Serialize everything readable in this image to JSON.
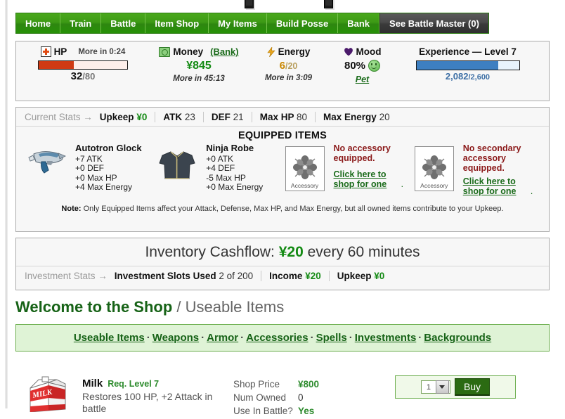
{
  "nav": {
    "items": [
      {
        "label": "Home",
        "active": false
      },
      {
        "label": "Train",
        "active": false
      },
      {
        "label": "Battle",
        "active": false
      },
      {
        "label": "Item Shop",
        "active": false
      },
      {
        "label": "My Items",
        "active": false
      },
      {
        "label": "Build Posse",
        "active": false
      },
      {
        "label": "Bank",
        "active": false
      },
      {
        "label": "See Battle Master (0)",
        "active": true
      }
    ]
  },
  "stats": {
    "hp": {
      "label": "HP",
      "timer": "More in 0:24",
      "current": "32",
      "max": "/80",
      "percent": 40,
      "bar_color": "#cf3a14",
      "bar_bg": "#fdeeea"
    },
    "money": {
      "label": "Money",
      "bank_link": "(Bank)",
      "amount": "¥845",
      "timer": "More in 45:13",
      "color": "#138a13"
    },
    "energy": {
      "label": "Energy",
      "current": "6",
      "max": "/20",
      "timer": "More in 3:09",
      "color": "#c98700"
    },
    "mood": {
      "label": "Mood",
      "percent": "80%",
      "pet_link": "Pet"
    },
    "experience": {
      "label": "Experience — Level 7",
      "current": "2,082",
      "max": "/2,600",
      "percent": 80,
      "bar_color": "#3d7fc1",
      "bar_bg": "#e8f4fd"
    }
  },
  "current_stats": {
    "label": "Current Stats →",
    "items": [
      {
        "key": "Upkeep",
        "value": "¥0",
        "yen": true
      },
      {
        "key": "ATK",
        "value": "23",
        "yen": false
      },
      {
        "key": "DEF",
        "value": "21",
        "yen": false
      },
      {
        "key": "Max HP",
        "value": "80",
        "yen": false
      },
      {
        "key": "Max Energy",
        "value": "20",
        "yen": false
      }
    ]
  },
  "equipped": {
    "title": "EQUIPPED ITEMS",
    "weapon": {
      "name": "Autotron Glock",
      "stats": [
        "+7 ATK",
        "+0 DEF",
        "+0 Max HP",
        "+4 Max Energy"
      ]
    },
    "armor": {
      "name": "Ninja Robe",
      "stats": [
        "+0 ATK",
        "+4 DEF",
        "-5 Max HP",
        "+0 Max Energy"
      ]
    },
    "accessory": {
      "caption": "Accessory",
      "empty_text": "No accessory equipped.",
      "link_text": "Click here to shop for one"
    },
    "secondary_accessory": {
      "caption": "Accessory",
      "empty_text": "No secondary accessory equipped.",
      "link_text": "Click here to shop for one"
    },
    "note_bold": "Note:",
    "note_text": " Only Equipped Items affect your Attack, Defense, Max HP, and Max Energy, but all owned items contribute to your Upkeep."
  },
  "cashflow": {
    "title_prefix": "Inventory Cashflow: ",
    "amount": "¥20",
    "title_suffix": " every 60 minutes",
    "stats_label": "Investment Stats →",
    "items": [
      {
        "key": "Investment Slots Used",
        "value": "2 of 200",
        "yen": false
      },
      {
        "key": "Income",
        "value": "¥20",
        "yen": true
      },
      {
        "key": "Upkeep",
        "value": "¥0",
        "yen": true
      }
    ]
  },
  "shop": {
    "heading_bold": "Welcome to the Shop",
    "heading_rest": " / Useable Items",
    "categories": [
      "Useable Items",
      "Weapons",
      "Armor",
      "Accessories",
      "Spells",
      "Investments",
      "Backgrounds"
    ],
    "category_separator": "·"
  },
  "item": {
    "icon": "milk-carton-icon",
    "name": "Milk",
    "req": "Req. Level 7",
    "description": "Restores 100 HP, +2 Attack in battle",
    "stats": [
      {
        "key": "Shop Price",
        "value": "¥800",
        "style": "green"
      },
      {
        "key": "Num Owned",
        "value": "0",
        "style": "plain"
      },
      {
        "key": "Use In Battle?",
        "value": "Yes",
        "style": "green"
      }
    ],
    "qty_value": "1",
    "buy_label": "Buy"
  },
  "colors": {
    "nav_green": "#3d9a15",
    "nav_active": "#3a3a3a",
    "money_green": "#138a13",
    "link_green": "#1a6b1a",
    "alert_red": "#8b1a1a"
  }
}
